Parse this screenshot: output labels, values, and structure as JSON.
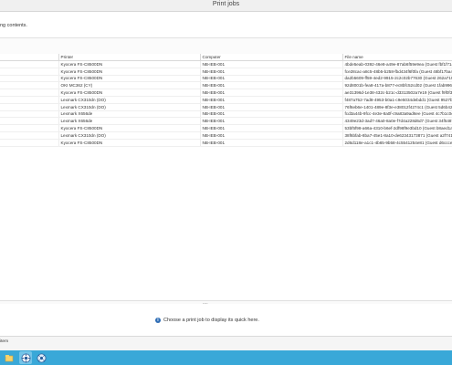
{
  "window": {
    "title": "Print jobs"
  },
  "infobar": {
    "message": "ng contents."
  },
  "table": {
    "columns": [
      "",
      "Printer",
      "Computer",
      "File name"
    ],
    "rows": [
      [
        "",
        "Kyocera FS-C8500DN",
        "NB-IEB-001",
        "4bde5eab-0392-46e8-a49e-87ab6f59e9ea (Guest fbf1f7144"
      ],
      [
        "",
        "Kyocera FS-C8500DN",
        "NB-IEB-001",
        "fce28cac-a8c5-48b5-b258-fbd434f6f0fa (Guest 48bf17ba4-"
      ],
      [
        "",
        "Kyocera FS-C8500DN",
        "NB-IEB-001",
        "da2b5609-ff59-4ed2-9915-2c2c02b77630 (Guest 262a7190-"
      ],
      [
        "",
        "OKI MC362 (CY)",
        "NB-IEB-001",
        "92d8001b-fea8-417a-b877-ec8bfc52cd02 (Guest 1fab99604"
      ],
      [
        "",
        "Kyocera FS-C8500DN",
        "NB-IEB-001",
        "ae31396d-1e38-432c-b21c-d3313502a7e19 (Guest f9f0f384"
      ],
      [
        "",
        "Lexmark CX310dn (DO)",
        "NB-IEB-001",
        "f487a752-7ad8-4953-b0a1-c9e5034debdd1 (Guest 9527b2c5"
      ],
      [
        "",
        "Lexmark CX310dn (DO)",
        "NB-IEB-001",
        "76f6eb6e-1401-489e-8f3e-e38012f4274c1 (Guest 5d6b42884"
      ],
      [
        "",
        "Lexmark X656de",
        "NB-IEB-001",
        "fcd3a44b-9fcc-4e3e-8a0f-c9a83a9ad6ee (Guest 4c7b1c0e-"
      ],
      [
        "",
        "Lexmark X656de",
        "NB-IEB-001",
        "4349e23d-3ad7-46a0-8a0e-f7d4a228d6d7 (Guest 34f5487b"
      ],
      [
        "",
        "Kyocera FS-C8500DN",
        "NB-IEB-001",
        "53bf5f98-a66a-4310-b6ef-2df98f9e3bd10 (Guest b8aed1a-"
      ],
      [
        "",
        "Lexmark CX310dn (DO)",
        "NB-IEB-001",
        "38f6bfab-8ba7-45e1-8a10-de62343173871 (Guest a2f741ec-"
      ],
      [
        "",
        "Kyocera FS-C8500DN",
        "NB-IEB-001",
        "2d6d118e-a1c1-4b65-9b58-4c5541254e81 (Guest d6ccce12-"
      ]
    ]
  },
  "preview": {
    "hint": "Choose a print job to display its quick here."
  },
  "statusbar": {
    "text": "item"
  },
  "taskbar": {
    "items": [
      {
        "name": "explorer-icon",
        "active": false
      },
      {
        "name": "print-management-icon",
        "active": true
      },
      {
        "name": "printer-app-icon",
        "active": false
      }
    ]
  }
}
